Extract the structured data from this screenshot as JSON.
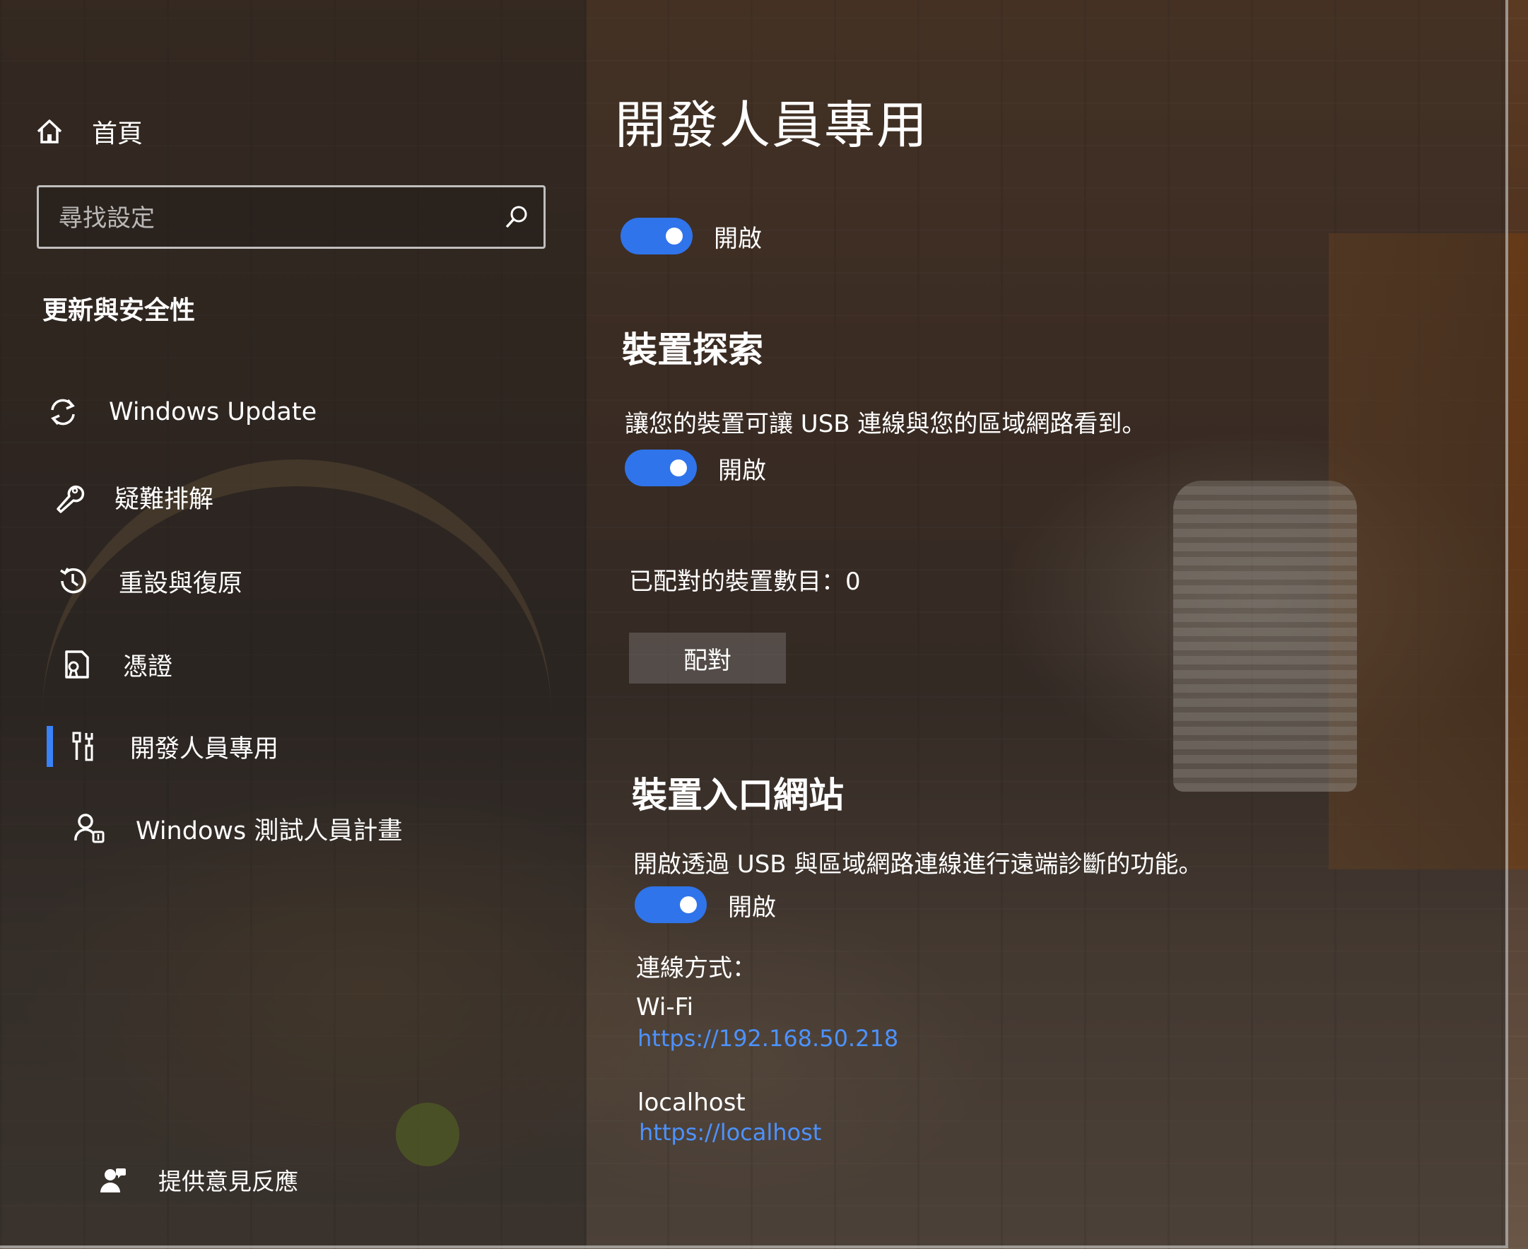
{
  "sidebar": {
    "home_label": "首頁",
    "search_placeholder": "尋找設定",
    "section_title": "更新與安全性",
    "items": [
      {
        "label": "Windows Update",
        "icon": "sync-icon"
      },
      {
        "label": "疑難排解",
        "icon": "wrench-icon"
      },
      {
        "label": "重設與復原",
        "icon": "history-icon"
      },
      {
        "label": "憑證",
        "icon": "certificate-icon"
      },
      {
        "label": "開發人員專用",
        "icon": "developer-tools-icon",
        "selected": true
      },
      {
        "label": "Windows 測試人員計畫",
        "icon": "insider-icon"
      }
    ],
    "feedback_label": "提供意見反應"
  },
  "main": {
    "title": "開發人員專用",
    "developer_mode": {
      "toggle_label": "開啟",
      "on": true
    },
    "device_discovery": {
      "heading": "裝置探索",
      "description": "讓您的裝置可讓 USB 連線與您的區域網路看到。",
      "toggle_label": "開啟",
      "on": true,
      "paired_count_text": "已配對的裝置數目：0",
      "pair_button": "配對"
    },
    "device_portal": {
      "heading": "裝置入口網站",
      "description": "開啟透過 USB 與區域網路連線進行遠端診斷的功能。",
      "toggle_label": "開啟",
      "on": true,
      "connect_label": "連線方式：",
      "connections": [
        {
          "name": "Wi-Fi",
          "url": "https://192.168.50.218"
        },
        {
          "name": "localhost",
          "url": "https://localhost"
        }
      ]
    }
  },
  "colors": {
    "accent": "#2f74ea",
    "link": "#4c92ff",
    "selection_bar": "#3a82f7"
  }
}
